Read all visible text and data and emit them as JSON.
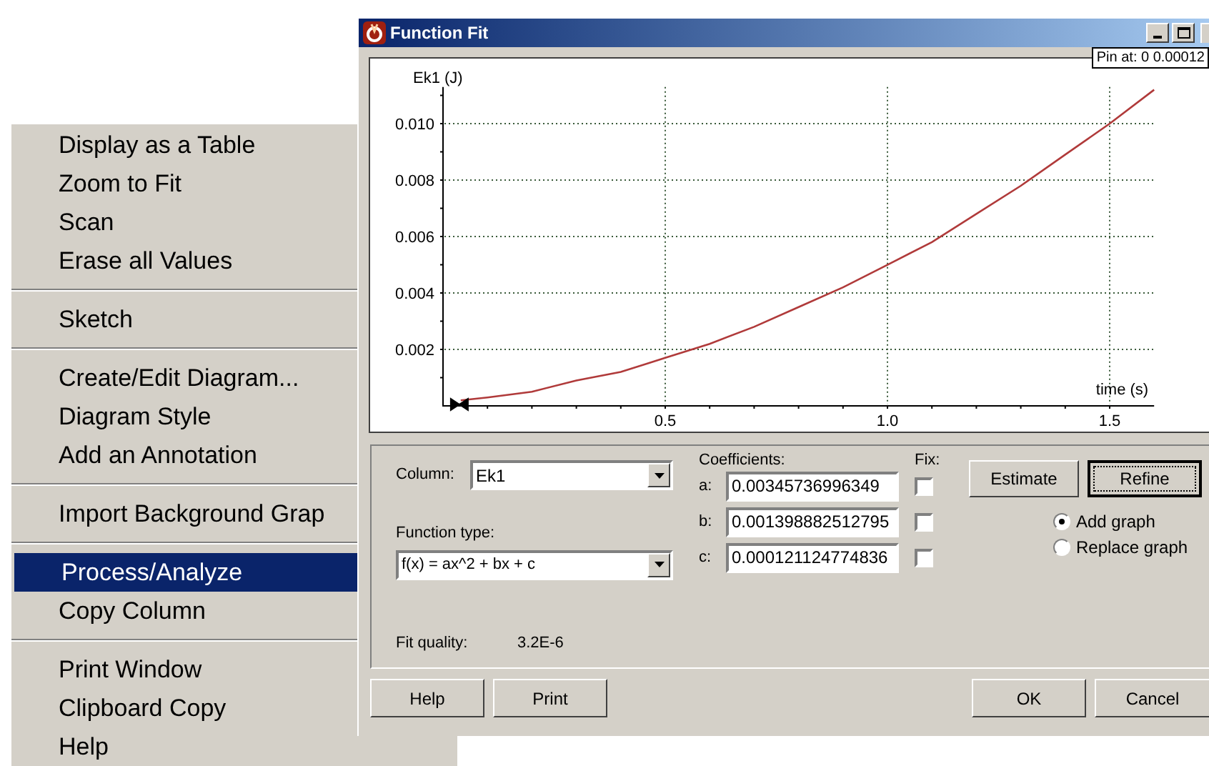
{
  "menu": {
    "items": [
      {
        "kind": "item",
        "label": "Display as a Table",
        "selected": false
      },
      {
        "kind": "item",
        "label": "Zoom to Fit",
        "selected": false
      },
      {
        "kind": "item",
        "label": "Scan",
        "selected": false
      },
      {
        "kind": "item",
        "label": "Erase all Values",
        "selected": false
      },
      {
        "kind": "separator"
      },
      {
        "kind": "item",
        "label": "Sketch",
        "selected": false
      },
      {
        "kind": "separator"
      },
      {
        "kind": "item",
        "label": "Create/Edit Diagram...",
        "selected": false
      },
      {
        "kind": "item",
        "label": "Diagram Style",
        "selected": false
      },
      {
        "kind": "item",
        "label": "Add an Annotation",
        "selected": false
      },
      {
        "kind": "separator"
      },
      {
        "kind": "item",
        "label": "Import Background Grap",
        "selected": false
      },
      {
        "kind": "separator"
      },
      {
        "kind": "item",
        "label": "Process/Analyze",
        "selected": true
      },
      {
        "kind": "item",
        "label": "Copy Column",
        "selected": false
      },
      {
        "kind": "separator"
      },
      {
        "kind": "item",
        "label": "Print Window",
        "selected": false
      },
      {
        "kind": "item",
        "label": "Clipboard Copy",
        "selected": false
      },
      {
        "kind": "item",
        "label": "Help",
        "selected": false
      }
    ]
  },
  "dialog": {
    "title": "Function Fit",
    "graph": {
      "pin_label": "Pin at: 0 0.00012",
      "chart_data": {
        "type": "line",
        "xlabel": "time (s)",
        "ylabel": "Ek1 (J)",
        "x": [
          0.04,
          0.1,
          0.2,
          0.3,
          0.4,
          0.5,
          0.6,
          0.7,
          0.8,
          0.9,
          1.0,
          1.1,
          1.2,
          1.3,
          1.4,
          1.5,
          1.6
        ],
        "series": [
          {
            "color": "#b03a3a",
            "values": [
              0.0002,
              0.0003,
              0.0005,
              0.0009,
              0.0012,
              0.0017,
              0.0022,
              0.0028,
              0.0035,
              0.0042,
              0.005,
              0.0058,
              0.0068,
              0.0078,
              0.0089,
              0.01,
              0.0112
            ]
          }
        ],
        "grid": true,
        "xlim": [
          0,
          1.6
        ],
        "ylim": [
          0,
          0.0113
        ],
        "xticks": [
          {
            "value": 0.5,
            "label": "0.5"
          },
          {
            "value": 1.0,
            "label": "1.0"
          },
          {
            "value": 1.5,
            "label": "1.5"
          }
        ],
        "yticks": [
          {
            "value": 0.002,
            "label": "0.002"
          },
          {
            "value": 0.004,
            "label": "0.004"
          },
          {
            "value": 0.006,
            "label": "0.006"
          },
          {
            "value": 0.008,
            "label": "0.008"
          },
          {
            "value": 0.01,
            "label": "0.010"
          }
        ]
      }
    },
    "column": {
      "label": "Column:",
      "value": "Ek1"
    },
    "function_type": {
      "label": "Function type:",
      "value": "f(x) = ax^2 + bx + c"
    },
    "coefficients_label": "Coefficients:",
    "fix_label": "Fix:",
    "coefficients": [
      {
        "name": "a:",
        "value": "0.00345736996349",
        "fixed": false
      },
      {
        "name": "b:",
        "value": "0.001398882512795",
        "fixed": false
      },
      {
        "name": "c:",
        "value": "0.000121124774836",
        "fixed": false
      }
    ],
    "estimate_button": "Estimate",
    "refine_button": "Refine",
    "graph_options": [
      {
        "label": "Add graph",
        "selected": true
      },
      {
        "label": "Replace graph",
        "selected": false
      }
    ],
    "fit_quality": {
      "label": "Fit quality:",
      "value": "3.2E-6"
    },
    "buttons": [
      "Help",
      "Print",
      "OK",
      "Cancel"
    ]
  }
}
